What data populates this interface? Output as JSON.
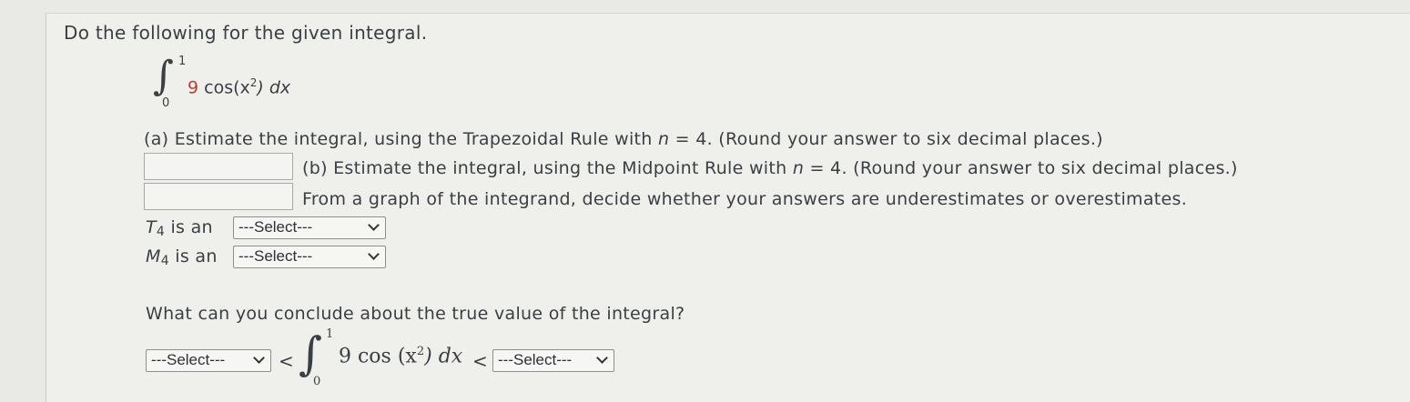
{
  "question": {
    "heading": "Do the following for the given integral.",
    "integral": {
      "upper": "1",
      "lower": "0",
      "coefficient": "9",
      "body": " cos(x",
      "power": "2",
      "tail": ") dx"
    },
    "part_a": {
      "text": "(a) Estimate the integral, using the Trapezoidal Rule with ",
      "var": "n",
      "rest": " = 4. (Round your answer to six decimal places.)",
      "answer": ""
    },
    "part_b": {
      "text": "(b) Estimate the integral, using the Midpoint Rule with ",
      "var": "n",
      "rest": " = 4. (Round your answer to six decimal places.)",
      "answer": ""
    },
    "part_c": {
      "text": "From a graph of the integrand, decide whether your answers are underestimates or overestimates."
    },
    "t4": {
      "symbol": "T",
      "subscript": "4",
      "label": " is an",
      "select": "---Select---"
    },
    "m4": {
      "symbol": "M",
      "subscript": "4",
      "label": " is an",
      "select": "---Select---"
    },
    "conclusion": {
      "text": "What can you conclude about the true value of the integral?",
      "left_select": "---Select---",
      "right_select": "---Select---",
      "lt": "<",
      "integral": {
        "upper": "1",
        "lower": "0",
        "body": "9 cos (x",
        "power": "2",
        "tail": ") dx"
      }
    }
  }
}
